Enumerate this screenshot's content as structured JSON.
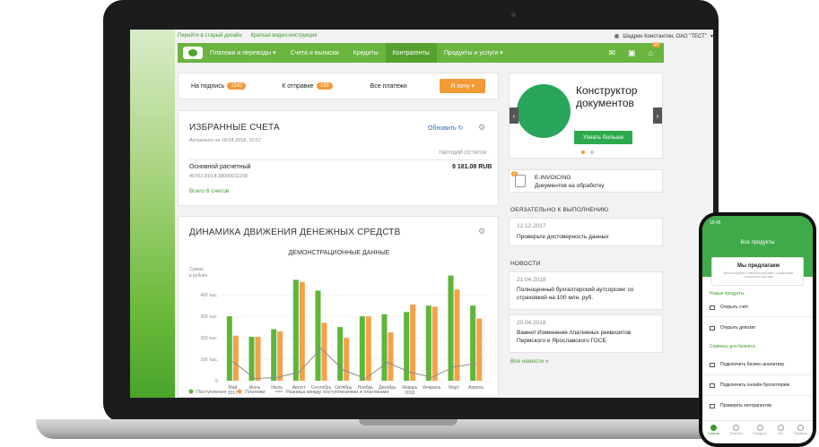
{
  "top_links": [
    "Перейти в старый дизайн",
    "Краткая видео-инструкция"
  ],
  "user": "Шадрин Константин, ОАО \"ТЕСТ\"",
  "nav": {
    "items": [
      "Платежи и переводы",
      "Счета и выписки",
      "Кредиты",
      "Контрагенты",
      "Продукты и услуги"
    ],
    "notif_count": "10"
  },
  "tabs": {
    "sign_label": "На подпись",
    "sign_count": "1142",
    "send_label": "К отправке",
    "send_count": "139",
    "all_label": "Все платежи",
    "want_label": "Я хочу"
  },
  "favorites": {
    "title": "ИЗБРАННЫЕ СЧЕТА",
    "updated": "Актуально на 18.04.2018, 10:57",
    "refresh": "Обновить",
    "col_header": "ТЕКУЩИЙ ОСТАТОК",
    "account_name": "Основной расчетный",
    "account_number": "40702.810.8.38000011158",
    "amount": "9 181.08 RUB",
    "all_link": "Всего 6 счетов"
  },
  "cashflow": {
    "title": "ДИНАМИКА ДВИЖЕНИЯ ДЕНЕЖНЫХ СРЕДСТВ",
    "subtitle": "ДЕМОНСТРАЦИОННЫЕ ДАННЫЕ"
  },
  "chart_data": {
    "type": "bar",
    "title": "ДЕМОНСТРАЦИОННЫЕ ДАННЫЕ",
    "ylabel": "Сумма в рублях",
    "yticks": [
      "0",
      "100 тыс.",
      "200 тыс.",
      "300 тыс.",
      "400 тыс."
    ],
    "ylim": [
      0,
      480
    ],
    "categories": [
      "Май 2017",
      "Июнь",
      "Июль",
      "Август",
      "Сентябрь",
      "Октябрь",
      "Ноябрь",
      "Декабрь",
      "Январь 2018",
      "Февраль",
      "Март",
      "Апрель"
    ],
    "series": [
      {
        "name": "Поступления",
        "color": "#5fb63a",
        "values": [
          300,
          205,
          240,
          470,
          420,
          250,
          300,
          310,
          320,
          350,
          490,
          350
        ]
      },
      {
        "name": "Платежи",
        "color": "#f4a24a",
        "values": [
          210,
          205,
          230,
          460,
          270,
          200,
          300,
          225,
          355,
          345,
          425,
          290
        ]
      },
      {
        "name": "Разница между поступлениями и платежами",
        "color": "#8a8a8a",
        "values": [
          90,
          10,
          15,
          40,
          150,
          50,
          10,
          85,
          40,
          15,
          65,
          80
        ]
      }
    ],
    "legend": "bottom"
  },
  "promo": {
    "title_line1": "Конструктор",
    "title_line2": "документов",
    "button": "Узнать больше"
  },
  "einvoicing": {
    "badge": "2",
    "title": "E-INVOICING",
    "subtitle": "Документов на обработку"
  },
  "required": {
    "header": "ОБЯЗАТЕЛЬНО К ВЫПОЛНЕНИЮ",
    "date": "12.12.2017",
    "text": "Проверьте достоверность данных"
  },
  "news": {
    "header": "НОВОСТИ",
    "items": [
      {
        "date": "21.04.2018",
        "text": "Полноценный бухгалтерский аутсорсинг со страховкой на 100 млн. руб."
      },
      {
        "date": "20.04.2018",
        "text": "Важно! Изменение платежных реквизитов Пермского и Ярославского ГОСБ"
      }
    ],
    "all_link": "Все новости »"
  },
  "phone": {
    "time": "16:45",
    "title": "Все продукты",
    "card_title": "Мы предлагаем",
    "card_sub": "Воспользуйтесь нашими услугами, созданными специально для вас",
    "sec1": "Новые продукты",
    "row1": "Открыть счёт",
    "row2": "Открыть депозит",
    "sec2": "Сервисы для бизнеса",
    "row3": "Подключить бизнес-аналитику",
    "row4": "Подключить онлайн бухгалтерию",
    "row5": "Проверить контрагентов",
    "tabs": [
      "Главная",
      "Платежи",
      "Продукты",
      "Чат",
      "Профиль"
    ]
  }
}
